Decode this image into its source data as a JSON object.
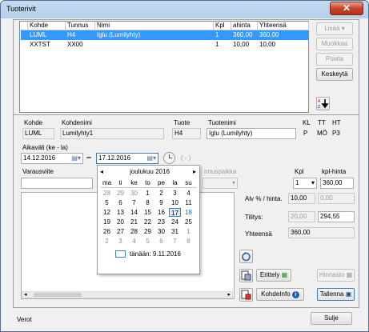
{
  "window": {
    "title": "Tuoterivit",
    "close_glyph": "✕"
  },
  "table": {
    "columns": [
      "Kohde",
      "Tunnus",
      "Nimi",
      "Kpl",
      "ahinta",
      "Yhteensä"
    ],
    "rows": [
      {
        "kohde": "LUML",
        "tunnus": "H4",
        "nimi": "Iglu (Lumilyhty)",
        "kpl": "1",
        "ahinta": "360,00",
        "yhteensa": "360,00",
        "selected": true
      },
      {
        "kohde": "XXTST",
        "tunnus": "XX00",
        "nimi": "",
        "kpl": "1",
        "ahinta": "10,00",
        "yhteensa": "10,00",
        "selected": false
      }
    ]
  },
  "side_buttons": {
    "lisaa": "Lisää",
    "muokkaa": "Muokkaa",
    "poista": "Poista",
    "keskeyta": "Keskeytä"
  },
  "detail": {
    "labels": {
      "kohde": "Kohde",
      "kohdenimi": "Kohdenimi",
      "tuote": "Tuote",
      "tuotenimi": "Tuotenimi",
      "kl": "KL",
      "tt": "TT",
      "ht": "HT"
    },
    "values": {
      "kohde": "LUML",
      "kohdenimi": "Lumilyhty1",
      "tuote": "H4",
      "tuotenimi": "Iglu (Lumilyhty)",
      "kl": "P",
      "tt": "MÖ",
      "ht": "P3"
    },
    "period_label": "Aikaväli (ke - la)",
    "date_from": "14.12.2016",
    "date_to": "17.12.2016",
    "dash": "–",
    "dash_note": "( - )",
    "varausviite": "Varausviite",
    "nnuspaikka": "nnuspaikka",
    "kpl_label": "Kpl",
    "kpl_value": "1",
    "kplhinta_label": "kpl-hinta",
    "kplhinta_value": "360,00",
    "alv_label": "Alv % / hinta.",
    "alv_pct": "10,00",
    "alv_value": "0,00",
    "tilitys_label": "Tilitys:",
    "tilitys_1": "20,00",
    "tilitys_2": "294,55",
    "yhteensa_label": "Yhteensä",
    "yhteensa_value": "360,00"
  },
  "calendar": {
    "month": "joulukuu 2016",
    "weekdays": [
      "ma",
      "ti",
      "ke",
      "to",
      "pe",
      "la",
      "su"
    ],
    "weeks": [
      [
        "28",
        "29",
        "30",
        "1",
        "2",
        "3",
        "4"
      ],
      [
        "5",
        "6",
        "7",
        "8",
        "9",
        "10",
        "11"
      ],
      [
        "12",
        "13",
        "14",
        "15",
        "16",
        "17",
        "18"
      ],
      [
        "19",
        "20",
        "21",
        "22",
        "23",
        "24",
        "25"
      ],
      [
        "26",
        "27",
        "28",
        "29",
        "30",
        "31",
        "1"
      ],
      [
        "2",
        "3",
        "4",
        "5",
        "6",
        "7",
        "8"
      ]
    ],
    "today_text": "tänään: 9.11.2016",
    "selected_day": "17"
  },
  "bottom_buttons": {
    "erittely": "Erittely",
    "hinnasto": "Hinnasto",
    "kohdeinfo": "KohdeInfo",
    "tallenna": "Tallenna"
  },
  "footer": {
    "verot": "Verot",
    "sulje": "Sulje"
  }
}
